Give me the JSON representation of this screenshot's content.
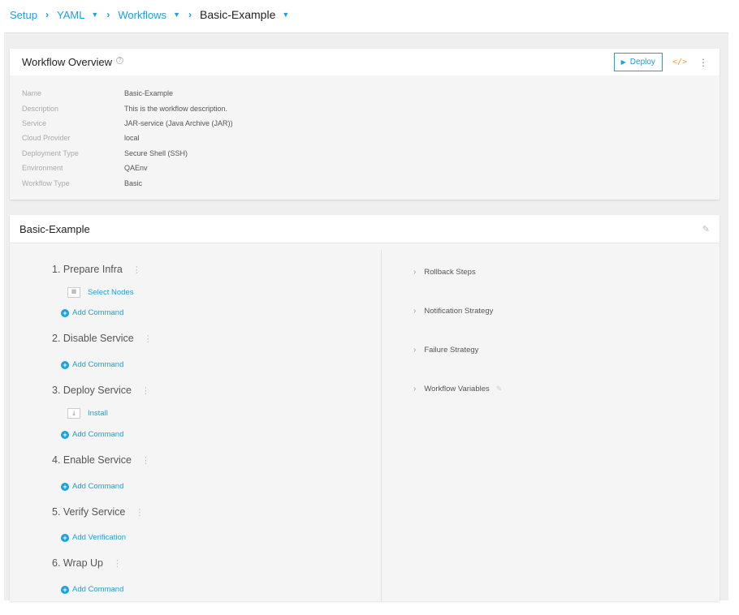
{
  "breadcrumb": {
    "setup": "Setup",
    "yaml": "YAML",
    "workflows": "Workflows",
    "current": "Basic-Example"
  },
  "overview": {
    "title": "Workflow Overview",
    "help": "?",
    "deploy_label": "Deploy",
    "properties": [
      {
        "label": "Name",
        "value": "Basic-Example"
      },
      {
        "label": "Description",
        "value": "This is the workflow description."
      },
      {
        "label": "Service",
        "value": "JAR-service (Java Archive (JAR))"
      },
      {
        "label": "Cloud Provider",
        "value": "local"
      },
      {
        "label": "Deployment Type",
        "value": "Secure Shell (SSH)"
      },
      {
        "label": "Environment",
        "value": "QAEnv"
      },
      {
        "label": "Workflow Type",
        "value": "Basic"
      }
    ]
  },
  "workflow": {
    "title": "Basic-Example",
    "phases": [
      {
        "label": "1. Prepare Infra",
        "step": "Select Nodes",
        "step_icon": "nodes-icon",
        "add": "Add Command"
      },
      {
        "label": "2. Disable Service",
        "add": "Add Command"
      },
      {
        "label": "3. Deploy Service",
        "step": "Install",
        "step_icon": "download-icon",
        "add": "Add Command"
      },
      {
        "label": "4. Enable Service",
        "add": "Add Command"
      },
      {
        "label": "5. Verify Service",
        "add": "Add Verification"
      },
      {
        "label": "6. Wrap Up",
        "add": "Add Command"
      }
    ],
    "side": [
      {
        "label": "Rollback Steps"
      },
      {
        "label": "Notification Strategy"
      },
      {
        "label": "Failure Strategy"
      },
      {
        "label": "Workflow Variables"
      }
    ]
  },
  "colors": {
    "accent": "#1aa1e0",
    "code_icon": "#f0a030"
  }
}
